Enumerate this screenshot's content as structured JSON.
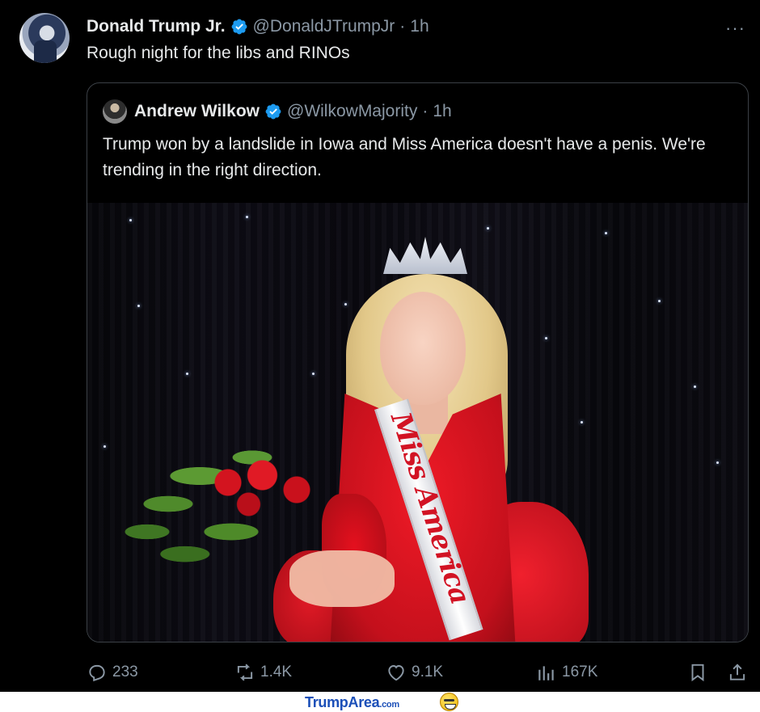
{
  "tweet": {
    "author_name": "Donald Trump Jr.",
    "author_handle": "@DonaldJTrumpJr",
    "separator": "·",
    "time": "1h",
    "more_label": "···",
    "text": "Rough night for the libs and RINOs",
    "verified": true
  },
  "quote": {
    "author_name": "Andrew Wilkow",
    "author_handle": "@WilkowMajority",
    "separator": "·",
    "time": "1h",
    "text": "Trump won by a landslide in Iowa and Miss America doesn't have a penis. We're trending in the right direction.",
    "verified": true,
    "image": {
      "sash_text": "Miss America"
    }
  },
  "actions": {
    "replies": "233",
    "reposts": "1.4K",
    "likes": "9.1K",
    "views": "167K"
  },
  "watermark": {
    "brand": "TrumpArea",
    "suffix": ".com"
  },
  "colors": {
    "background": "#000000",
    "text": "#e7e9ea",
    "muted": "#8b98a5",
    "verified": "#1d9bf0",
    "border": "#3b4046"
  }
}
